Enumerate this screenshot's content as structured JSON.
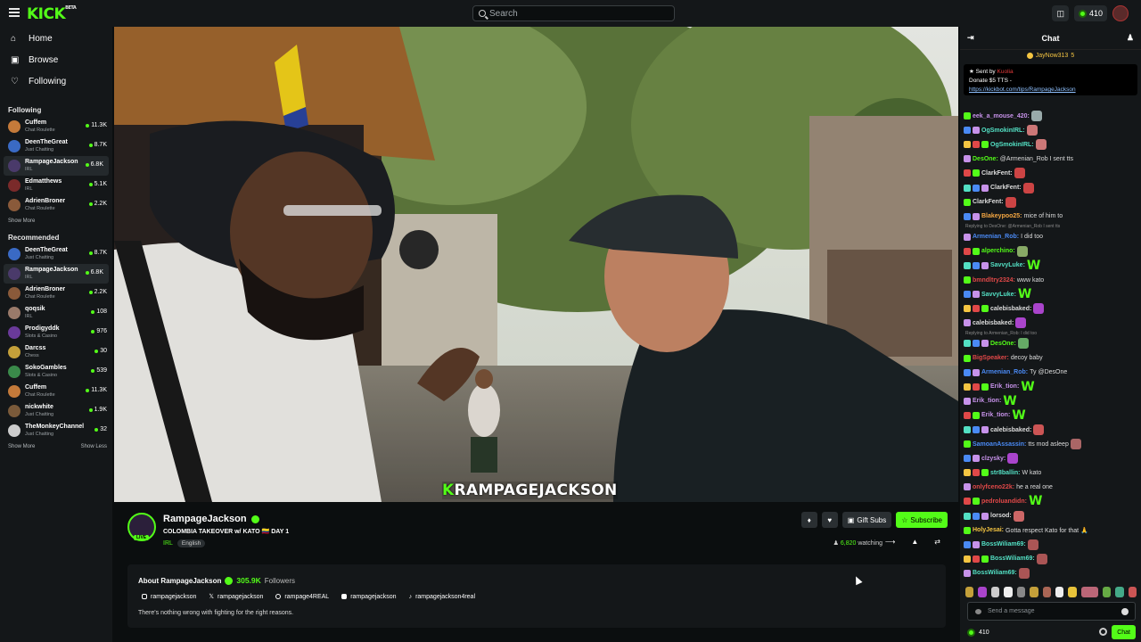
{
  "topbar": {
    "logo": "KICK",
    "logo_tag": "BETA",
    "search_placeholder": "Search",
    "coins": "410"
  },
  "nav": [
    {
      "label": "Home",
      "icon": "home-icon"
    },
    {
      "label": "Browse",
      "icon": "browse-icon"
    },
    {
      "label": "Following",
      "icon": "heart-icon"
    }
  ],
  "following": {
    "title": "Following",
    "channels": [
      {
        "name": "Cuffem",
        "category": "Chat Roulette",
        "viewers": "11.3K",
        "color": "#c47a3a"
      },
      {
        "name": "DeenTheGreat",
        "category": "Just Chatting",
        "viewers": "8.7K",
        "color": "#3a6ac4"
      },
      {
        "name": "RampageJackson",
        "category": "IRL",
        "viewers": "6.8K",
        "color": "#4a3a6a"
      },
      {
        "name": "Edmatthews",
        "category": "IRL",
        "viewers": "5.1K",
        "color": "#7a2a2a"
      },
      {
        "name": "AdrienBroner",
        "category": "Chat Roulette",
        "viewers": "2.2K",
        "color": "#8a5a3a"
      }
    ],
    "show_more": "Show More"
  },
  "recommended": {
    "title": "Recommended",
    "channels": [
      {
        "name": "DeenTheGreat",
        "category": "Just Chatting",
        "viewers": "8.7K",
        "color": "#3a6ac4"
      },
      {
        "name": "RampageJackson",
        "category": "IRL",
        "viewers": "6.8K",
        "color": "#4a3a6a"
      },
      {
        "name": "AdrienBroner",
        "category": "Chat Roulette",
        "viewers": "2.2K",
        "color": "#8a5a3a"
      },
      {
        "name": "qoqsik",
        "category": "IRL",
        "viewers": "108",
        "color": "#9a7a6a"
      },
      {
        "name": "Prodigyddk",
        "category": "Slots & Casino",
        "viewers": "976",
        "color": "#6a3a9a"
      },
      {
        "name": "Darcss",
        "category": "Chess",
        "viewers": "30",
        "color": "#c4a03a"
      },
      {
        "name": "SokoGambles",
        "category": "Slots & Casino",
        "viewers": "539",
        "color": "#3a8a4a"
      },
      {
        "name": "Cuffem",
        "category": "Chat Roulette",
        "viewers": "11.3K",
        "color": "#c47a3a"
      },
      {
        "name": "nickwhite",
        "category": "Just Chatting",
        "viewers": "1.9K",
        "color": "#7a5a3a"
      },
      {
        "name": "TheMonkeyChannel",
        "category": "Just Chatting",
        "viewers": "32",
        "color": "#cccccc"
      }
    ],
    "show_more": "Show More",
    "show_less": "Show Less"
  },
  "video": {
    "caption_first": "K",
    "caption_rest": "RAMPAGEJACKSON"
  },
  "stream": {
    "name": "RampageJackson",
    "live": "LIVE",
    "title": "COLOMBIA TAKEOVER w/ KATO 🇨🇴 DAY 1",
    "category": "IRL",
    "language": "English",
    "gift_label": "Gift Subs",
    "subscribe_label": "Subscribe",
    "viewers": "6,820",
    "watching": "watching"
  },
  "about": {
    "title": "About RampageJackson",
    "followers": "305.9K",
    "followers_label": "Followers",
    "socials": [
      "rampagejackson",
      "rampagejackson",
      "rampage4REAL",
      "rampagejackson",
      "rampagejackson4real"
    ],
    "description": "There's nothing wrong with fighting for the right reasons."
  },
  "chat": {
    "title": "Chat",
    "pinned_user": "JayNow313",
    "pinned_count": "5",
    "pin_sent_by": "Sent by",
    "pin_sender": "Kuolia",
    "pin_text": "Donate $5 TTS -",
    "pin_link": "https://kickbot.com/tips/RampageJackson",
    "messages": [
      {
        "user": "eek_a_mouse_420:",
        "color": "#c792ea",
        "text": "",
        "emote": "#9aa"
      },
      {
        "user": "OgSmokinIRL:",
        "color": "#53e0c4",
        "text": "",
        "emote": "#c77"
      },
      {
        "user": "OgSmokinIRL:",
        "color": "#53e0c4",
        "text": "",
        "emote": "#c77"
      },
      {
        "user": "DesOne:",
        "color": "#53fc18",
        "text": "@Armenian_Rob I sent tts",
        "emote": ""
      },
      {
        "user": "ClarkFent:",
        "color": "#ddd",
        "text": "",
        "emote": "#c44"
      },
      {
        "user": "ClarkFent:",
        "color": "#ddd",
        "text": "",
        "emote": "#c44"
      },
      {
        "user": "ClarkFent:",
        "color": "#ddd",
        "text": "",
        "emote": "#c44"
      },
      {
        "user": "Blakeypoo25:",
        "color": "#f5a742",
        "text": "mice of him to",
        "emote": ""
      },
      {
        "reply": "Replying to DesOne: @Armenian_Rob I sent tts"
      },
      {
        "user": "Armenian_Rob:",
        "color": "#4a8af5",
        "text": "I did too",
        "emote": ""
      },
      {
        "user": "alperchino:",
        "color": "#53fc18",
        "text": "",
        "emote": "#8a6"
      },
      {
        "user": "SavvyLuke:",
        "color": "#53e0c4",
        "text": "",
        "emote": "W"
      },
      {
        "user": "bmndltry2324:",
        "color": "#e04848",
        "text": "www kato",
        "emote": ""
      },
      {
        "user": "SavvyLuke:",
        "color": "#53e0c4",
        "text": "",
        "emote": "W"
      },
      {
        "user": "calebisbaked:",
        "color": "#ddd",
        "text": "",
        "emote": "#a4c"
      },
      {
        "user": "calebisbaked:",
        "color": "#ddd",
        "text": "",
        "emote": "#a4c"
      },
      {
        "reply": "Replying to Armenian_Rob: I did too"
      },
      {
        "user": "DesOne:",
        "color": "#53fc18",
        "text": "",
        "emote": "#6a6"
      },
      {
        "user": "BigSpeaker:",
        "color": "#e04848",
        "text": "decoy baby",
        "emote": ""
      },
      {
        "user": "Armenian_Rob:",
        "color": "#4a8af5",
        "text": "Ty @DesOne",
        "emote": ""
      },
      {
        "user": "Erik_tion:",
        "color": "#c792ea",
        "text": "",
        "emote": "W"
      },
      {
        "user": "Erik_tion:",
        "color": "#c792ea",
        "text": "",
        "emote": "W"
      },
      {
        "user": "Erik_tion:",
        "color": "#c792ea",
        "text": "",
        "emote": "W"
      },
      {
        "user": "calebisbaked:",
        "color": "#ddd",
        "text": "",
        "emote": "#c55"
      },
      {
        "user": "SamoanAssassin:",
        "color": "#4a8af5",
        "text": "tts mod asleep",
        "emote": "#a66"
      },
      {
        "user": "clzysky:",
        "color": "#c792ea",
        "text": "",
        "emote": "#a4c"
      },
      {
        "user": "str8ballin:",
        "color": "#53e0c4",
        "text": "W kato",
        "emote": ""
      },
      {
        "user": "onlyfceno22k:",
        "color": "#e04848",
        "text": "he a real one",
        "emote": ""
      },
      {
        "user": "pedroluandidn:",
        "color": "#e04848",
        "text": "",
        "emote": "W"
      },
      {
        "user": "lorsod:",
        "color": "#ddd",
        "text": "",
        "emote": "#c66"
      },
      {
        "user": "HolyJesai:",
        "color": "#f5c542",
        "text": "Gotta respect Kato for that 🙏",
        "emote": ""
      },
      {
        "user": "BossWiliam69:",
        "color": "#53e0c4",
        "text": "",
        "emote": "#a55"
      },
      {
        "user": "BossWiliam69:",
        "color": "#53e0c4",
        "text": "",
        "emote": "#a55"
      },
      {
        "user": "BossWiliam69:",
        "color": "#53e0c4",
        "text": "",
        "emote": "#a55"
      }
    ],
    "input_placeholder": "Send a message",
    "coins": "410",
    "send_label": "Chat"
  }
}
